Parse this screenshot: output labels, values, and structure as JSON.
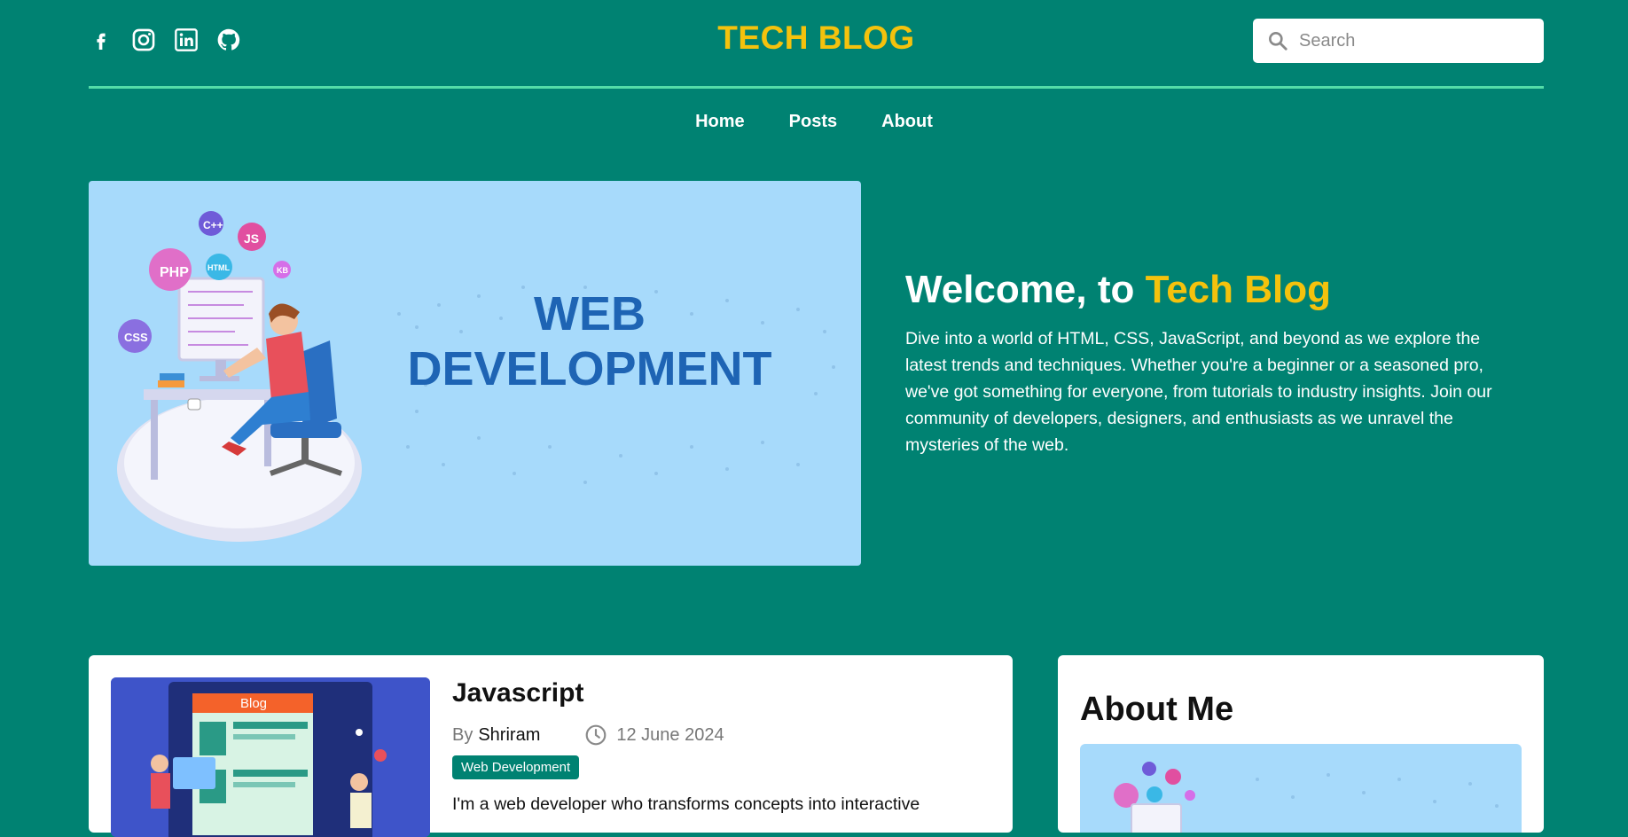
{
  "header": {
    "brand": "TECH BLOG",
    "search": {
      "placeholder": "Search",
      "icon": "search-icon"
    },
    "socials": [
      {
        "name": "facebook",
        "icon": "facebook-icon"
      },
      {
        "name": "instagram",
        "icon": "instagram-icon"
      },
      {
        "name": "linkedin",
        "icon": "linkedin-icon"
      },
      {
        "name": "github",
        "icon": "github-icon"
      }
    ]
  },
  "nav": {
    "items": [
      "Home",
      "Posts",
      "About"
    ]
  },
  "hero": {
    "image": {
      "line1": "WEB",
      "line2": "DEVELOPMENT",
      "badges": [
        "PHP",
        "C++",
        "JS",
        "HTML",
        "CSS",
        "KB"
      ]
    },
    "heading_prefix": "Welcome, to ",
    "heading_accent": "Tech Blog",
    "description": "Dive into a world of HTML, CSS, JavaScript, and beyond as we explore the latest trends and techniques. Whether you're a beginner or a seasoned pro, we've got something for everyone, from tutorials to industry insights. Join our community of developers, designers, and enthusiasts as we unravel the mysteries of the web."
  },
  "post": {
    "thumb_label": "Blog",
    "title": "Javascript",
    "by_label": "By",
    "author": "Shriram",
    "date": "12 June 2024",
    "tag": "Web Development",
    "excerpt": "I'm a web developer who transforms concepts into interactive"
  },
  "about": {
    "title": "About Me"
  },
  "colors": {
    "background": "#008272",
    "accent": "#f4c20d",
    "divider": "#54dca8",
    "hero_image_bg": "#a7dafb",
    "tag_bg": "#008272",
    "headline_blue": "#1e64b4"
  }
}
